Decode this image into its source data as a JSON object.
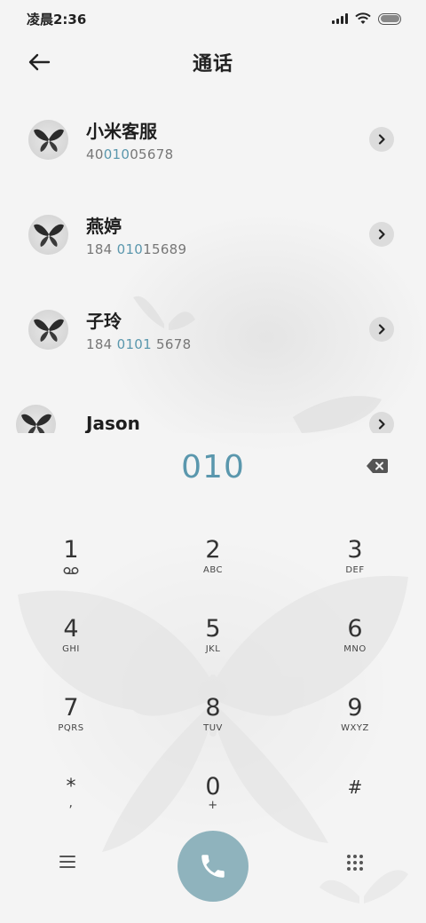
{
  "status_bar": {
    "time": "凌晨2:36"
  },
  "header": {
    "title": "通话"
  },
  "contacts": [
    {
      "name": "小米客服",
      "number_prefix": "40",
      "number_match": "010",
      "number_suffix": "05678"
    },
    {
      "name": "燕婷",
      "number_prefix": "184 ",
      "number_match": "010",
      "number_suffix": "15689"
    },
    {
      "name": "子玲",
      "number_prefix": "184 ",
      "number_match": "0101",
      "number_suffix": " 5678"
    },
    {
      "name": "Jason",
      "number_prefix": "",
      "number_match": "",
      "number_suffix": ""
    }
  ],
  "dialer": {
    "input_value": "010",
    "keys": [
      {
        "digit": "1",
        "letters": ""
      },
      {
        "digit": "2",
        "letters": "ABC"
      },
      {
        "digit": "3",
        "letters": "DEF"
      },
      {
        "digit": "4",
        "letters": "GHI"
      },
      {
        "digit": "5",
        "letters": "JKL"
      },
      {
        "digit": "6",
        "letters": "MNO"
      },
      {
        "digit": "7",
        "letters": "PQRS"
      },
      {
        "digit": "8",
        "letters": "TUV"
      },
      {
        "digit": "9",
        "letters": "WXYZ"
      },
      {
        "digit": "*",
        "letters": ","
      },
      {
        "digit": "0",
        "letters": "+"
      },
      {
        "digit": "#",
        "letters": ""
      }
    ]
  },
  "icons": {
    "back": "arrow-left-icon",
    "detail": "chevron-right-icon",
    "backspace": "backspace-icon",
    "voicemail": "voicemail-icon",
    "menu": "menu-icon",
    "call": "phone-icon",
    "keypad": "dialpad-icon"
  },
  "colors": {
    "accent": "#5a97ad",
    "call_button": "#8fb3bd",
    "background": "#f4f4f4"
  }
}
